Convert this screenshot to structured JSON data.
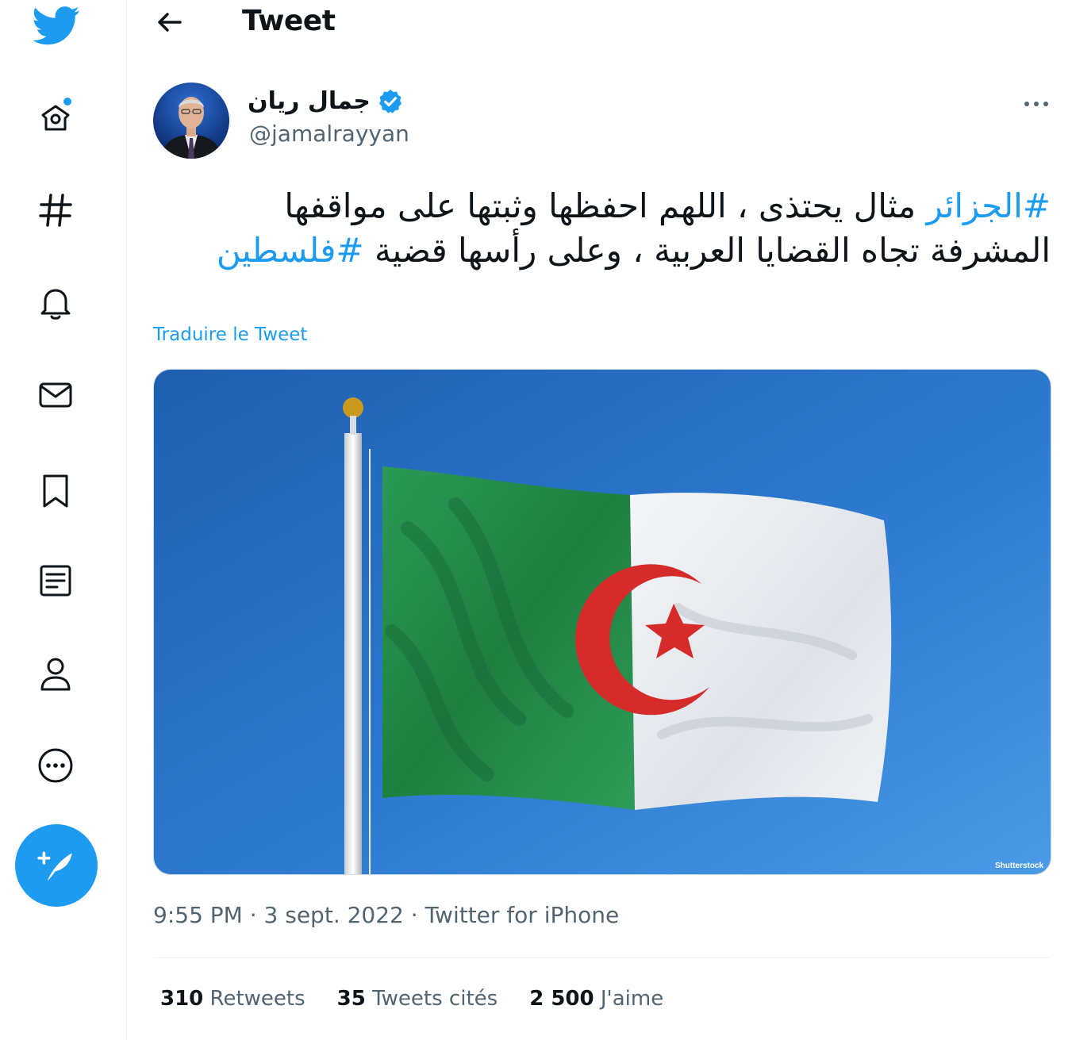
{
  "app": {
    "name": "Twitter",
    "accent": "#1d9bf0"
  },
  "header": {
    "title": "Tweet"
  },
  "sidebar": {
    "items": [
      {
        "name": "home",
        "icon": "home-icon",
        "has_notification_dot": true
      },
      {
        "name": "explore",
        "icon": "hashtag-icon"
      },
      {
        "name": "notifications",
        "icon": "bell-icon"
      },
      {
        "name": "messages",
        "icon": "envelope-icon"
      },
      {
        "name": "bookmarks",
        "icon": "bookmark-icon"
      },
      {
        "name": "lists",
        "icon": "list-icon"
      },
      {
        "name": "profile",
        "icon": "person-icon"
      },
      {
        "name": "more",
        "icon": "more-circle-icon"
      }
    ],
    "compose_icon": "feather-plus-icon"
  },
  "tweet": {
    "author": {
      "display_name": "جمال ريان",
      "handle": "@jamalrayyan",
      "verified": true
    },
    "text": {
      "hashtag_1": "#الجزائر",
      "body": " مثال يحتذى ، اللهم احفظها وثبتها على مواقفها المشرفة تجاه القضايا العربية ، وعلى رأسها قضية ",
      "hashtag_2": "#فلسطين"
    },
    "translate_label": "Traduire le Tweet",
    "media": {
      "watermark": "Shutterstock"
    },
    "meta": {
      "time": "9:55 PM",
      "date": "3 sept. 2022",
      "source": "Twitter for iPhone",
      "separator": " · "
    },
    "stats": {
      "retweets_count": "310",
      "retweets_label": "Retweets",
      "quotes_count": "35",
      "quotes_label": "Tweets cités",
      "likes_count": "2 500",
      "likes_label": "J'aime"
    }
  }
}
